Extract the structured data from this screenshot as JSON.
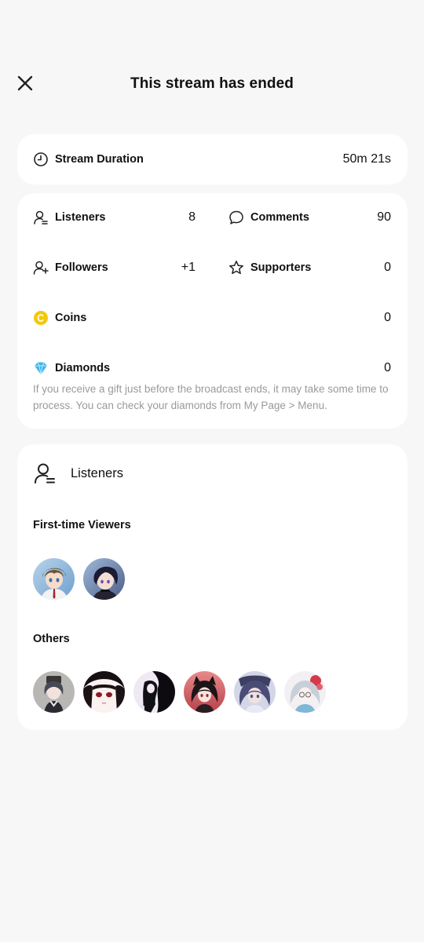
{
  "header": {
    "title": "This stream has ended"
  },
  "duration": {
    "label": "Stream Duration",
    "value": "50m 21s"
  },
  "stats": {
    "listeners": {
      "label": "Listeners",
      "value": "8"
    },
    "comments": {
      "label": "Comments",
      "value": "90"
    },
    "followers": {
      "label": "Followers",
      "value": "+1"
    },
    "supporters": {
      "label": "Supporters",
      "value": "0"
    },
    "coins": {
      "label": "Coins",
      "value": "0"
    },
    "diamonds": {
      "label": "Diamonds",
      "value": "0"
    },
    "note": "If you receive a gift just before the broadcast ends, it may take some time to process. You can check your diamonds from My Page > Menu."
  },
  "listeners_section": {
    "title": "Listeners",
    "first_time_title": "First-time Viewers",
    "others_title": "Others",
    "first_time_count": 2,
    "others_count": 6
  },
  "colors": {
    "background": "#f7f7f7",
    "card": "#ffffff",
    "coin": "#f2c90c",
    "diamond": "#3fb6ea",
    "note_text": "#9a9a9a"
  }
}
